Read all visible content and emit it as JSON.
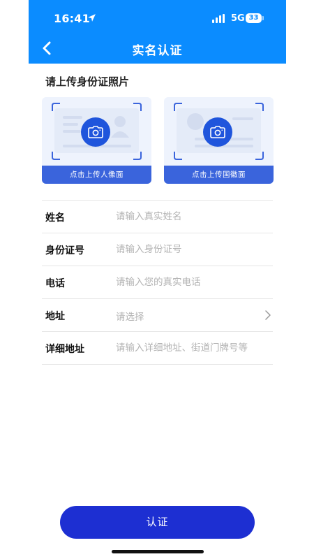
{
  "status_bar": {
    "time": "16:41",
    "network": "5G",
    "battery": "33"
  },
  "nav": {
    "title": "实名认证",
    "back_icon": "chevron-left-icon"
  },
  "upload": {
    "section_title": "请上传身份证照片",
    "front_label": "点击上传人像面",
    "back_label": "点击上传国徽面",
    "camera_icon": "camera-icon"
  },
  "form": {
    "name": {
      "label": "姓名",
      "placeholder": "请输入真实姓名"
    },
    "id_number": {
      "label": "身份证号",
      "placeholder": "请输入身份证号"
    },
    "phone": {
      "label": "电话",
      "placeholder": "请输入您的真实电话"
    },
    "address": {
      "label": "地址",
      "value": "请选择"
    },
    "detail_address": {
      "label": "详细地址",
      "placeholder": "请输入详细地址、街道门牌号等"
    }
  },
  "submit_label": "认证",
  "colors": {
    "header": "#0b8cff",
    "accent": "#1f55dc",
    "submit": "#1d2fd2"
  }
}
